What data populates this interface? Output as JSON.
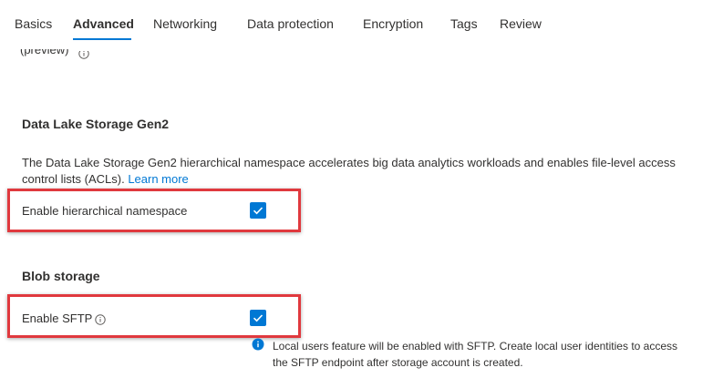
{
  "tabs": [
    {
      "label": "Basics"
    },
    {
      "label": "Advanced"
    },
    {
      "label": "Networking"
    },
    {
      "label": "Data protection"
    },
    {
      "label": "Encryption"
    },
    {
      "label": "Tags"
    },
    {
      "label": "Review"
    }
  ],
  "active_tab": "Advanced",
  "cutoff_row": {
    "label": "(preview)"
  },
  "data_lake": {
    "title": "Data Lake Storage Gen2",
    "description": "The Data Lake Storage Gen2 hierarchical namespace accelerates big data analytics workloads and enables file-level access control lists (ACLs).",
    "learn_more": "Learn more",
    "hierarchical_namespace": {
      "label": "Enable hierarchical namespace",
      "checked": true
    }
  },
  "blob_storage": {
    "title": "Blob storage",
    "sftp": {
      "label": "Enable SFTP",
      "checked": true
    },
    "note": "Local users feature will be enabled with SFTP. Create local user identities to access the SFTP endpoint after storage account is created."
  },
  "colors": {
    "accent": "#0078d4",
    "highlight": "#e0393e",
    "text": "#323130"
  }
}
